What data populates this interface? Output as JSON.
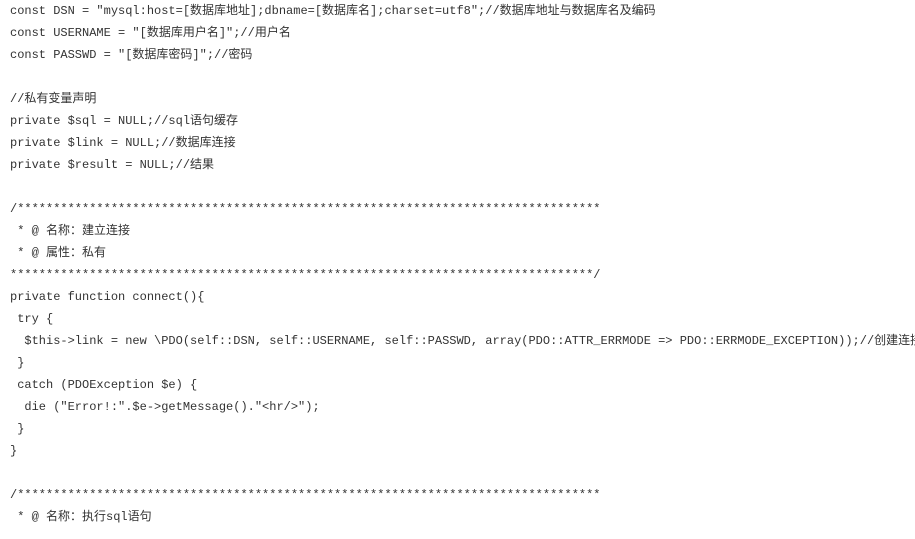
{
  "code": {
    "lines": [
      "const DSN = \"mysql:host=[数据库地址];dbname=[数据库名];charset=utf8\";//数据库地址与数据库名及编码",
      "const USERNAME = \"[数据库用户名]\";//用户名",
      "const PASSWD = \"[数据库密码]\";//密码",
      "",
      "//私有变量声明",
      "private $sql = NULL;//sql语句缓存",
      "private $link = NULL;//数据库连接",
      "private $result = NULL;//结果",
      "",
      "/*********************************************************************************",
      " * @ 名称：建立连接",
      " * @ 属性：私有",
      "*********************************************************************************/",
      "private function connect(){",
      " try {",
      "  $this->link = new \\PDO(self::DSN, self::USERNAME, self::PASSWD, array(PDO::ATTR_ERRMODE => PDO::ERRMODE_EXCEPTION));//创建连接",
      " }",
      " catch (PDOException $e) {",
      "  die (\"Error!:\".$e->getMessage().\"<hr/>\");",
      " }",
      "}",
      "",
      "/*********************************************************************************",
      " * @ 名称：执行sql语句"
    ]
  }
}
